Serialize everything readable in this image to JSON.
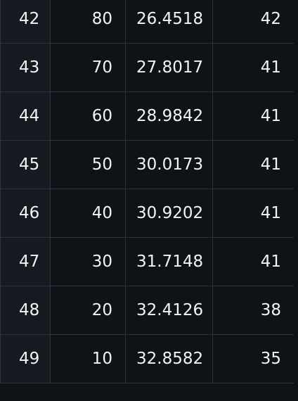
{
  "table": {
    "rows": [
      {
        "index": "42",
        "col1": "80",
        "col2": "26.4518",
        "col3": "42"
      },
      {
        "index": "43",
        "col1": "70",
        "col2": "27.8017",
        "col3": "41"
      },
      {
        "index": "44",
        "col1": "60",
        "col2": "28.9842",
        "col3": "41"
      },
      {
        "index": "45",
        "col1": "50",
        "col2": "30.0173",
        "col3": "41"
      },
      {
        "index": "46",
        "col1": "40",
        "col2": "30.9202",
        "col3": "41"
      },
      {
        "index": "47",
        "col1": "30",
        "col2": "31.7148",
        "col3": "41"
      },
      {
        "index": "48",
        "col1": "20",
        "col2": "32.4126",
        "col3": "38"
      },
      {
        "index": "49",
        "col1": "10",
        "col2": "32.8582",
        "col3": "35"
      }
    ]
  },
  "colors": {
    "background": "#0f1217",
    "index_background": "#161a20",
    "border": "#2f3339",
    "text": "#f2f4f6",
    "index_text": "#8b9097"
  }
}
